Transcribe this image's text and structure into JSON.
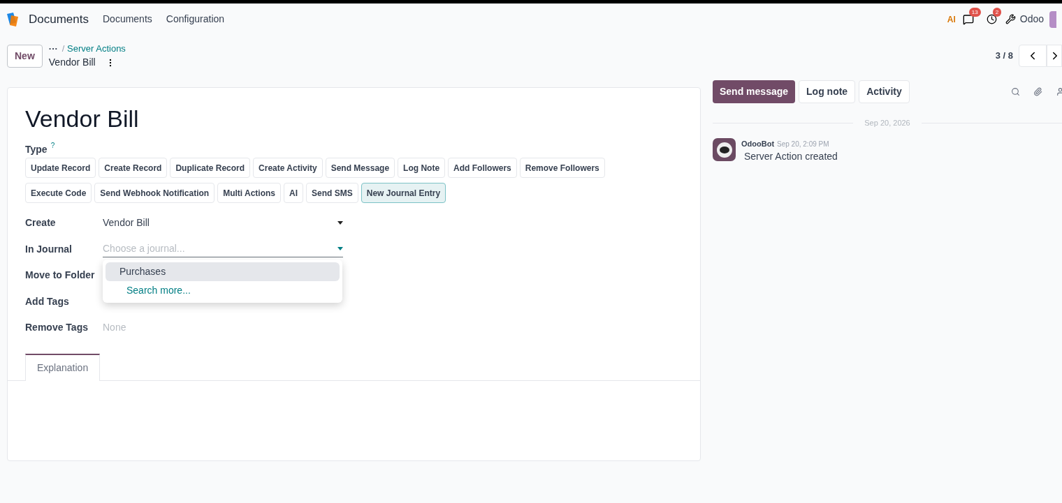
{
  "navbar": {
    "app_name": "Documents",
    "menu": [
      "Documents",
      "Configuration"
    ],
    "ai_logo": "AI",
    "badges": {
      "messages": "13",
      "activities": "2"
    },
    "company": "Odoo"
  },
  "control_panel": {
    "new_button": "New",
    "breadcrumb_ellipsis": "···",
    "breadcrumb_separator": "/",
    "breadcrumb_parent": "Server Actions",
    "breadcrumb_current": "Vendor Bill",
    "pager": "3 / 8"
  },
  "form": {
    "title": "Vendor Bill",
    "type_label": "Type",
    "type_help": "?",
    "type_options": [
      {
        "label": "Update Record",
        "selected": false
      },
      {
        "label": "Create Record",
        "selected": false
      },
      {
        "label": "Duplicate Record",
        "selected": false
      },
      {
        "label": "Create Activity",
        "selected": false
      },
      {
        "label": "Send Message",
        "selected": false
      },
      {
        "label": "Log Note",
        "selected": false
      },
      {
        "label": "Add Followers",
        "selected": false
      },
      {
        "label": "Remove Followers",
        "selected": false
      },
      {
        "label": "Execute Code",
        "selected": false
      },
      {
        "label": "Send Webhook Notification",
        "selected": false
      },
      {
        "label": "Multi Actions",
        "selected": false
      },
      {
        "label": "AI",
        "selected": false
      },
      {
        "label": "Send SMS",
        "selected": false
      },
      {
        "label": "New Journal Entry",
        "selected": true
      }
    ],
    "fields": [
      {
        "label": "Create",
        "kind": "select",
        "value": "Vendor Bill",
        "focused": false
      },
      {
        "label": "In Journal",
        "kind": "select",
        "placeholder": "Choose a journal...",
        "focused": true,
        "dropdown": {
          "options": [
            {
              "label": "Purchases",
              "selected": true
            }
          ],
          "search_more": "Search more..."
        }
      },
      {
        "label": "Move to Folder",
        "kind": "hidden"
      },
      {
        "label": "Add Tags",
        "kind": "hidden"
      },
      {
        "label": "Remove Tags",
        "kind": "tags",
        "placeholder": "None"
      }
    ],
    "tabs": [
      {
        "label": "Explanation",
        "selected": true
      }
    ]
  },
  "chatter": {
    "buttons": [
      {
        "label": "Send message",
        "selected": true
      },
      {
        "label": "Log note",
        "selected": false
      },
      {
        "label": "Activity",
        "selected": false
      }
    ],
    "date_separator": "Sep 20, 2026",
    "messages": [
      {
        "author": "OdooBot",
        "time": "Sep 20, 2:09 PM",
        "body": "Server Action created"
      }
    ]
  }
}
